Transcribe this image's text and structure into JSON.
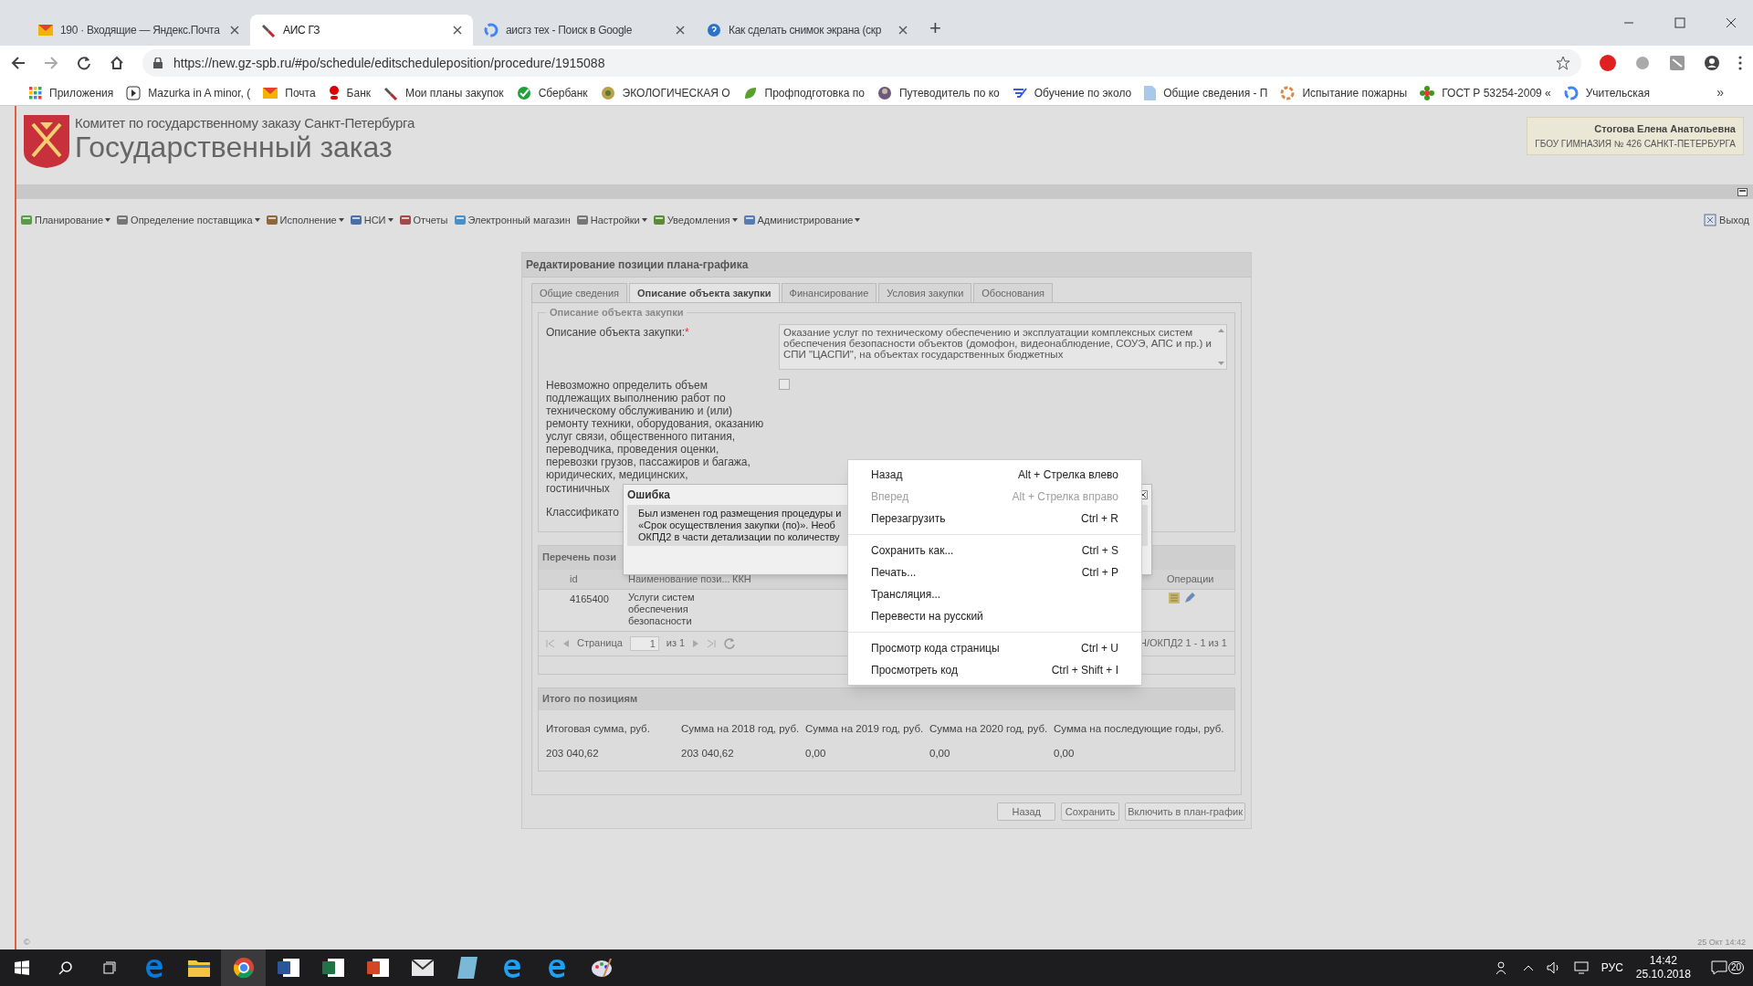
{
  "browser": {
    "tabs": [
      {
        "title": "190 · Входящие — Яндекс.Почта",
        "selected": false,
        "kind": "mail"
      },
      {
        "title": "АИС ГЗ",
        "selected": true,
        "kind": "tool"
      },
      {
        "title": "аисгз тех - Поиск в Google",
        "selected": false,
        "kind": "google"
      },
      {
        "title": "Как сделать снимок экрана (скр",
        "selected": false,
        "kind": "help"
      }
    ],
    "new_tab": "+",
    "url": "https://new.gz-spb.ru/#po/schedule/editscheduleposition/procedure/1915088",
    "bookmarks": [
      {
        "label": "Приложения",
        "kind": "apps"
      },
      {
        "label": "Mazurka in A minor, (",
        "kind": "play"
      },
      {
        "label": "Почта",
        "kind": "mail"
      },
      {
        "label": "Банк",
        "kind": "pin"
      },
      {
        "label": "Мои планы закупок",
        "kind": "tool"
      },
      {
        "label": "Сбербанк",
        "kind": "green"
      },
      {
        "label": "ЭКОЛОГИЧЕСКАЯ О",
        "kind": "emblem"
      },
      {
        "label": "Профподготовка по",
        "kind": "leaf"
      },
      {
        "label": "Путеводитель по ко",
        "kind": "avatar"
      },
      {
        "label": "Обучение по эколо",
        "kind": "check"
      },
      {
        "label": "Общие сведения - П",
        "kind": "doc"
      },
      {
        "label": "Испытание пожарны",
        "kind": "ring"
      },
      {
        "label": "ГОСТ Р 53254-2009 «",
        "kind": "flower"
      },
      {
        "label": "Учительская",
        "kind": "google"
      }
    ],
    "bookmarks_more": "»"
  },
  "site": {
    "org": "Комитет по государственному заказу Санкт-Петербурга",
    "title": "Государственный заказ",
    "user": {
      "name": "Стогова Елена Анатольевна",
      "org": "ГБОУ ГИМНАЗИЯ № 426 САНКТ-ПЕТЕРБУРГА"
    },
    "menu": [
      {
        "label": "Планирование",
        "dropdown": true
      },
      {
        "label": "Определение поставщика",
        "dropdown": true
      },
      {
        "label": "Исполнение",
        "dropdown": true
      },
      {
        "label": "НСИ",
        "dropdown": true
      },
      {
        "label": "Отчеты",
        "dropdown": false
      },
      {
        "label": "Электронный магазин",
        "dropdown": false
      },
      {
        "label": "Настройки",
        "dropdown": true
      },
      {
        "label": "Уведомления",
        "dropdown": true
      },
      {
        "label": "Администрирование",
        "dropdown": true
      }
    ],
    "logout": "Выход"
  },
  "form": {
    "title": "Редактирование позиции плана-графика",
    "tabs": [
      {
        "label": "Общие сведения",
        "selected": false
      },
      {
        "label": "Описание объекта закупки",
        "selected": true
      },
      {
        "label": "Финансирование",
        "selected": false
      },
      {
        "label": "Условия закупки",
        "selected": false
      },
      {
        "label": "Обоснования",
        "selected": false
      }
    ],
    "legend": "Описание объекта закупки",
    "description_label": "Описание объекта закупки:",
    "required_mark": "*",
    "description_value": "Оказание услуг по техническому обеспечению и эксплуатации комплексных систем обеспечения безопасности объектов (домофон, видеонаблюдение, СОУЭ, АПС и пр.) и СПИ \"ЦАСПИ\", на объектах государственных бюджетных",
    "volume_label": "Невозможно определить объем подлежащих выполнению работ по техническому обслуживанию и (или) ремонту техники, оборудования, оказанию услуг связи, общественного питания, переводчика, проведения оценки, перевозки грузов, пассажиров и багажа, юридических, медицинских,",
    "volume_label_tail": "гостиничных",
    "volume_checked": false,
    "classifier_label": "Классификато",
    "positions": {
      "title": "Перечень пози",
      "columns": [
        "id",
        "Наименование пози...",
        "ККН",
        "Операции"
      ],
      "rows": [
        {
          "id": "4165400",
          "name": "Услуги систем обеспечения безопасности"
        }
      ],
      "page_label": "Страница",
      "page": "1",
      "page_of": "из 1",
      "summary": "Н/ОКПД2 1 - 1 из 1"
    },
    "totals": {
      "title": "Итого по позициям",
      "columns": [
        "Итоговая сумма, руб.",
        "Сумма на 2018 год, руб.",
        "Сумма на 2019 год, руб.",
        "Сумма на 2020 год, руб.",
        "Сумма на последующие годы, руб."
      ],
      "values": [
        "203 040,62",
        "203 040,62",
        "0,00",
        "0,00",
        "0,00"
      ]
    },
    "buttons": [
      "Назад",
      "Сохранить",
      "Включить в план-график"
    ]
  },
  "error_dialog": {
    "title": "Ошибка",
    "lines": [
      "Был изменен год размещения процедуры и",
      "«Срок осуществления закупки (по)». Необ",
      "ОКПД2 в части детализации по количеству"
    ]
  },
  "context_menu": [
    {
      "kind": "item",
      "label": "Назад",
      "shortcut": "Alt + Стрелка влево",
      "disabled": false
    },
    {
      "kind": "item",
      "label": "Вперед",
      "shortcut": "Alt + Стрелка вправо",
      "disabled": true
    },
    {
      "kind": "item",
      "label": "Перезагрузить",
      "shortcut": "Ctrl + R",
      "disabled": false
    },
    {
      "kind": "separator"
    },
    {
      "kind": "item",
      "label": "Сохранить как...",
      "shortcut": "Ctrl + S",
      "disabled": false
    },
    {
      "kind": "item",
      "label": "Печать...",
      "shortcut": "Ctrl + P",
      "disabled": false
    },
    {
      "kind": "item",
      "label": "Трансляция...",
      "disabled": false
    },
    {
      "kind": "item",
      "label": "Перевести на русский",
      "disabled": false
    },
    {
      "kind": "separator"
    },
    {
      "kind": "item",
      "label": "Просмотр кода страницы",
      "shortcut": "Ctrl + U",
      "disabled": false
    },
    {
      "kind": "item",
      "label": "Просмотреть код",
      "shortcut": "Ctrl + Shift + I",
      "disabled": false
    }
  ],
  "footer": {
    "copyright": "©",
    "datetime": "25 Окт 14:42"
  },
  "taskbar": {
    "apps": [
      {
        "kind": "edge",
        "selected": false
      },
      {
        "kind": "folder",
        "selected": false
      },
      {
        "kind": "chrome",
        "selected": true
      },
      {
        "kind": "word",
        "selected": false
      },
      {
        "kind": "excel",
        "selected": false
      },
      {
        "kind": "powerpoint",
        "selected": false
      },
      {
        "kind": "mail",
        "selected": false
      },
      {
        "kind": "notes",
        "selected": false
      },
      {
        "kind": "ie",
        "selected": false
      },
      {
        "kind": "ie",
        "selected": false
      },
      {
        "kind": "paint",
        "selected": false
      }
    ],
    "lang": "РУС",
    "time": "14:42",
    "date": "25.10.2018",
    "notifications": "20"
  }
}
